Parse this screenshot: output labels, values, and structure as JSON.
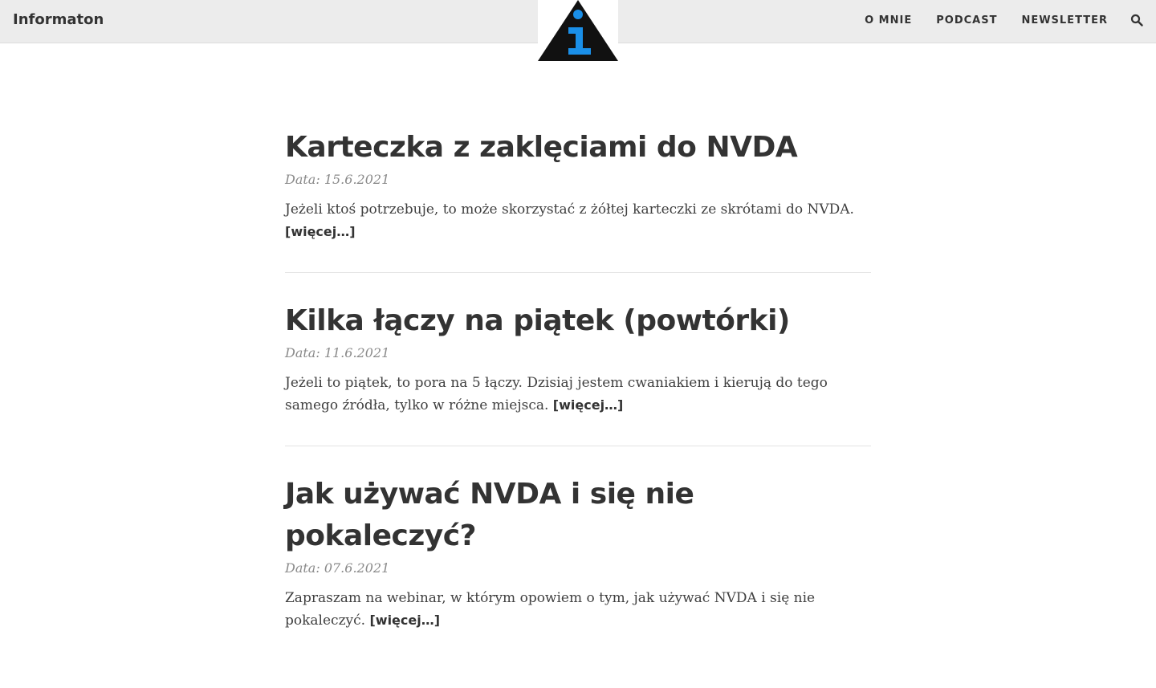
{
  "header": {
    "brand": "Informaton",
    "nav": [
      "O MNIE",
      "PODCAST",
      "NEWSLETTER"
    ],
    "search_icon": "search-icon",
    "logo_icon": "info-triangle-logo",
    "colors": {
      "bar": "#ececec",
      "logo_triangle": "#111111",
      "logo_i": "#1a8fe8"
    }
  },
  "posts": [
    {
      "title": "Karteczka z zaklęciami do NVDA",
      "date": "Data: 15.6.2021",
      "excerpt": "Jeżeli ktoś potrzebuje, to może skorzystać z żółtej karteczki ze skrótami do NVDA.",
      "more": "[więcej…]"
    },
    {
      "title": "Kilka łączy na piątek (powtórki)",
      "date": "Data: 11.6.2021",
      "excerpt": "Jeżeli to piątek, to pora na 5 łączy. Dzisiaj jestem cwaniakiem i kierują do tego samego źródła, tylko w różne miejsca.",
      "more": "[więcej…]"
    },
    {
      "title": "Jak używać NVDA i się nie pokaleczyć?",
      "date": "Data: 07.6.2021",
      "excerpt": "Zapraszam na webinar, w którym opowiem o tym, jak używać NVDA i się nie pokaleczyć.",
      "more": "[więcej…]"
    }
  ]
}
